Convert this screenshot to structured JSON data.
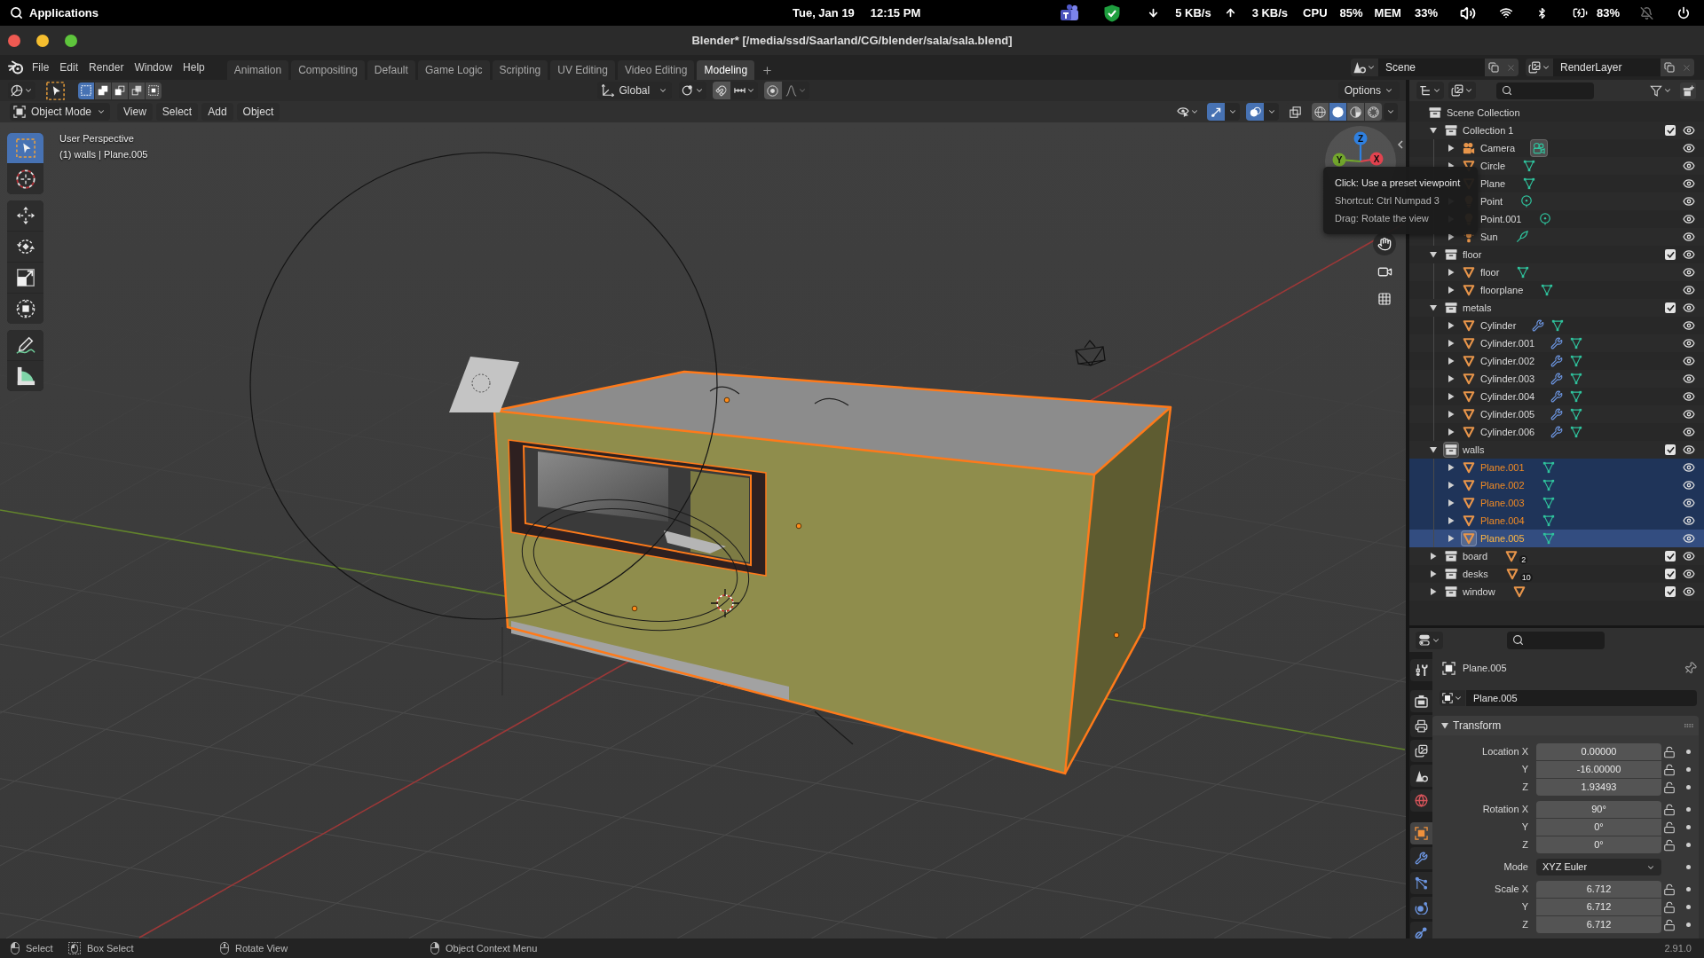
{
  "system_bar": {
    "menu": "Applications",
    "date": "Tue, Jan 19",
    "time": "12:15 PM",
    "download": "5 KB/s",
    "upload": "3 KB/s",
    "cpu_label": "CPU",
    "cpu": "85%",
    "mem_label": "MEM",
    "mem": "33%",
    "battery": "83%"
  },
  "window": {
    "title": "Blender* [/media/ssd/Saarland/CG/blender/sala/sala.blend]"
  },
  "menu_bar": [
    "File",
    "Edit",
    "Render",
    "Window",
    "Help"
  ],
  "workspace_tabs": [
    {
      "label": "Animation",
      "selected": false
    },
    {
      "label": "Compositing",
      "selected": false
    },
    {
      "label": "Default",
      "selected": false
    },
    {
      "label": "Game Logic",
      "selected": false
    },
    {
      "label": "Scripting",
      "selected": false
    },
    {
      "label": "UV Editing",
      "selected": false
    },
    {
      "label": "Video Editing",
      "selected": false
    },
    {
      "label": "Modeling",
      "selected": true
    }
  ],
  "scene": "Scene",
  "view_layer": "RenderLayer",
  "tool_header": {
    "select_modes": [
      {
        "kind": "set",
        "selected": true
      },
      {
        "kind": "extend",
        "selected": false
      },
      {
        "kind": "subtract",
        "selected": false
      },
      {
        "kind": "invert",
        "selected": false
      },
      {
        "kind": "intersect",
        "selected": false
      }
    ],
    "orientation": "Global",
    "options": "Options"
  },
  "viewport_header": {
    "mode": "Object Mode",
    "menus": [
      "View",
      "Select",
      "Add",
      "Object"
    ],
    "toggles": [
      {
        "kind": "gizmos",
        "on": true
      },
      {
        "kind": "overlays",
        "on": true
      },
      {
        "kind": "xray",
        "on": false
      }
    ],
    "shading": [
      {
        "kind": "wireframe",
        "selected": false
      },
      {
        "kind": "solid",
        "selected": true
      },
      {
        "kind": "material",
        "selected": false
      },
      {
        "kind": "rendered",
        "selected": false
      }
    ]
  },
  "toolbar": {
    "groups": [
      {
        "tools": [
          {
            "kind": "select_box",
            "selected": true
          },
          {
            "kind": "cursor",
            "selected": false
          }
        ]
      },
      {
        "tools": [
          {
            "kind": "move",
            "selected": false
          },
          {
            "kind": "rotate",
            "selected": false
          },
          {
            "kind": "scale",
            "selected": false
          },
          {
            "kind": "transform",
            "selected": false
          }
        ]
      },
      {
        "tools": [
          {
            "kind": "annotate",
            "selected": false
          },
          {
            "kind": "measure",
            "selected": false
          }
        ]
      }
    ]
  },
  "viewport": {
    "view_name": "User Perspective",
    "context": "(1) walls | Plane.005",
    "gizmo_axes": [
      {
        "label": "Z",
        "color": "#2f80e0"
      },
      {
        "label": "X",
        "color": "#e2434f"
      },
      {
        "label": "Y",
        "color": "#72a62c"
      }
    ]
  },
  "tooltip": {
    "lines": [
      "Click: Use a preset viewpoint",
      "Shortcut: Ctrl Numpad 3",
      "Drag: Rotate the view"
    ]
  },
  "outliner": {
    "root": "Scene Collection",
    "items": [
      {
        "name": "Collection 1",
        "kind": "collection",
        "expanded": true,
        "checked": true,
        "selected": false,
        "active": false,
        "children": [
          {
            "name": "Camera",
            "kind": "camera",
            "expanded": false,
            "selected": false,
            "active": false,
            "extras": [
              {
                "kind": "camera",
                "active": true
              }
            ]
          },
          {
            "name": "Circle",
            "kind": "mesh",
            "expanded": false,
            "selected": false,
            "active": false,
            "extras": [
              {
                "kind": "mesh"
              }
            ]
          },
          {
            "name": "Plane",
            "kind": "mesh",
            "expanded": false,
            "selected": false,
            "active": false,
            "extras": [
              {
                "kind": "mesh"
              }
            ]
          },
          {
            "name": "Point",
            "kind": "point_light",
            "expanded": false,
            "selected": false,
            "active": false,
            "extras": [
              {
                "kind": "point_light"
              }
            ]
          },
          {
            "name": "Point.001",
            "kind": "point_light",
            "expanded": false,
            "selected": false,
            "active": false,
            "extras": [
              {
                "kind": "point_light"
              }
            ]
          },
          {
            "name": "Sun",
            "kind": "sun_light",
            "expanded": false,
            "selected": false,
            "active": false,
            "extras": [
              {
                "kind": "sun_light"
              }
            ]
          }
        ]
      },
      {
        "name": "floor",
        "kind": "collection",
        "expanded": true,
        "checked": true,
        "selected": false,
        "active": false,
        "children": [
          {
            "name": "floor",
            "kind": "mesh",
            "expanded": false,
            "selected": false,
            "active": false,
            "extras": [
              {
                "kind": "mesh"
              }
            ]
          },
          {
            "name": "floorplane",
            "kind": "mesh",
            "expanded": false,
            "selected": false,
            "active": false,
            "extras": [
              {
                "kind": "mesh"
              }
            ]
          }
        ]
      },
      {
        "name": "metals",
        "kind": "collection",
        "expanded": true,
        "checked": true,
        "selected": false,
        "active": false,
        "children": [
          {
            "name": "Cylinder",
            "kind": "mesh",
            "expanded": false,
            "selected": false,
            "active": false,
            "extras": [
              {
                "kind": "modifier"
              },
              {
                "kind": "mesh"
              }
            ]
          },
          {
            "name": "Cylinder.001",
            "kind": "mesh",
            "expanded": false,
            "selected": false,
            "active": false,
            "extras": [
              {
                "kind": "modifier"
              },
              {
                "kind": "mesh"
              }
            ]
          },
          {
            "name": "Cylinder.002",
            "kind": "mesh",
            "expanded": false,
            "selected": false,
            "active": false,
            "extras": [
              {
                "kind": "modifier"
              },
              {
                "kind": "mesh"
              }
            ]
          },
          {
            "name": "Cylinder.003",
            "kind": "mesh",
            "expanded": false,
            "selected": false,
            "active": false,
            "extras": [
              {
                "kind": "modifier"
              },
              {
                "kind": "mesh"
              }
            ]
          },
          {
            "name": "Cylinder.004",
            "kind": "mesh",
            "expanded": false,
            "selected": false,
            "active": false,
            "extras": [
              {
                "kind": "modifier"
              },
              {
                "kind": "mesh"
              }
            ]
          },
          {
            "name": "Cylinder.005",
            "kind": "mesh",
            "expanded": false,
            "selected": false,
            "active": false,
            "extras": [
              {
                "kind": "modifier"
              },
              {
                "kind": "mesh"
              }
            ]
          },
          {
            "name": "Cylinder.006",
            "kind": "mesh",
            "expanded": false,
            "selected": false,
            "active": false,
            "extras": [
              {
                "kind": "modifier"
              },
              {
                "kind": "mesh"
              }
            ]
          }
        ]
      },
      {
        "name": "walls",
        "kind": "collection",
        "expanded": true,
        "checked": true,
        "selected": false,
        "active": true,
        "children": [
          {
            "name": "Plane.001",
            "kind": "mesh",
            "expanded": false,
            "selected": true,
            "active": false,
            "extras": [
              {
                "kind": "mesh"
              }
            ]
          },
          {
            "name": "Plane.002",
            "kind": "mesh",
            "expanded": false,
            "selected": true,
            "active": false,
            "extras": [
              {
                "kind": "mesh"
              }
            ]
          },
          {
            "name": "Plane.003",
            "kind": "mesh",
            "expanded": false,
            "selected": true,
            "active": false,
            "extras": [
              {
                "kind": "mesh"
              }
            ]
          },
          {
            "name": "Plane.004",
            "kind": "mesh",
            "expanded": false,
            "selected": true,
            "active": false,
            "extras": [
              {
                "kind": "mesh"
              }
            ]
          },
          {
            "name": "Plane.005",
            "kind": "mesh",
            "expanded": false,
            "selected": true,
            "active": true,
            "extras": [
              {
                "kind": "mesh"
              }
            ]
          }
        ]
      },
      {
        "name": "board",
        "kind": "collection",
        "expanded": false,
        "checked": true,
        "selected": false,
        "active": false,
        "extras": [
          {
            "kind": "object_mesh",
            "count": "2"
          }
        ]
      },
      {
        "name": "desks",
        "kind": "collection",
        "expanded": false,
        "checked": true,
        "selected": false,
        "active": false,
        "extras": [
          {
            "kind": "object_mesh",
            "count": "10"
          }
        ]
      },
      {
        "name": "window",
        "kind": "collection",
        "expanded": false,
        "checked": true,
        "selected": false,
        "active": false,
        "extras": [
          {
            "kind": "object_mesh"
          }
        ]
      }
    ]
  },
  "properties": {
    "tab_groups": [
      {
        "tabs": [
          {
            "kind": "tool",
            "selected": false
          }
        ]
      },
      {
        "tabs": [
          {
            "kind": "render",
            "selected": false
          },
          {
            "kind": "output",
            "selected": false
          },
          {
            "kind": "view_layer",
            "selected": false
          },
          {
            "kind": "scene",
            "selected": false
          },
          {
            "kind": "world",
            "selected": false
          }
        ]
      },
      {
        "tabs": [
          {
            "kind": "object",
            "selected": true
          },
          {
            "kind": "modifiers",
            "selected": false
          },
          {
            "kind": "particles",
            "selected": false
          },
          {
            "kind": "physics",
            "selected": false
          },
          {
            "kind": "constraints",
            "selected": false
          }
        ]
      }
    ],
    "object_name": "Plane.005",
    "name_field": "Plane.005",
    "panel": {
      "title": "Transform",
      "expanded": true,
      "groups": [
        {
          "rows": [
            {
              "kind": "number",
              "label": "Location X",
              "value": "0.00000"
            },
            {
              "kind": "number",
              "label": "Y",
              "value": "-16.00000"
            },
            {
              "kind": "number",
              "label": "Z",
              "value": "1.93493"
            }
          ]
        },
        {
          "rows": [
            {
              "kind": "number",
              "label": "Rotation X",
              "value": "90°"
            },
            {
              "kind": "number",
              "label": "Y",
              "value": "0°"
            },
            {
              "kind": "number",
              "label": "Z",
              "value": "0°"
            }
          ]
        },
        {
          "rows": [
            {
              "kind": "dropdown",
              "label": "Mode",
              "value": "XYZ Euler"
            }
          ]
        },
        {
          "rows": [
            {
              "kind": "number",
              "label": "Scale X",
              "value": "6.712"
            },
            {
              "kind": "number",
              "label": "Y",
              "value": "6.712"
            },
            {
              "kind": "number",
              "label": "Z",
              "value": "6.712"
            }
          ]
        }
      ]
    }
  },
  "status_bar": {
    "hints": [
      {
        "kind": "left_click",
        "label": "Select"
      },
      {
        "kind": "box_drag",
        "label": "Box Select"
      },
      {
        "kind": "middle_click",
        "label": "Rotate View"
      },
      {
        "kind": "right_click",
        "label": "Object Context Menu"
      }
    ],
    "version": "2.91.0"
  }
}
